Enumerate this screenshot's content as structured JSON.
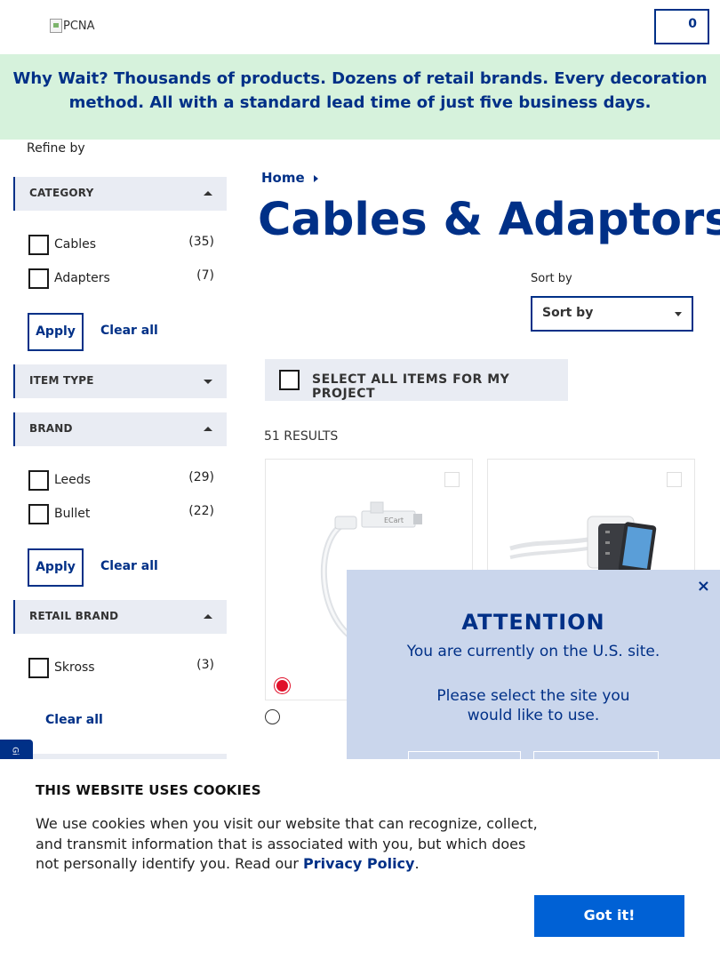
{
  "header": {
    "logo_alt": "PCNA",
    "cart_count": "0"
  },
  "promo": {
    "text": "Why Wait? Thousands of products. Dozens of retail brands. Every decoration method. All with a standard lead time of just five business days."
  },
  "sidebar": {
    "refine_label": "Refine by",
    "category": {
      "title": "CATEGORY",
      "options": [
        {
          "label": "Cables",
          "count": "(35)"
        },
        {
          "label": "Adapters",
          "count": "(7)"
        }
      ],
      "apply": "Apply",
      "clear": "Clear all"
    },
    "item_type": {
      "title": "ITEM TYPE"
    },
    "brand": {
      "title": "BRAND",
      "options": [
        {
          "label": "Leeds",
          "count": "(29)"
        },
        {
          "label": "Bullet",
          "count": "(22)"
        }
      ],
      "apply": "Apply",
      "clear": "Clear all"
    },
    "retail_brand": {
      "title": "RETAIL BRAND",
      "options": [
        {
          "label": "Skross",
          "count": "(3)"
        }
      ],
      "clear": "Clear all"
    }
  },
  "main": {
    "breadcrumb": "Home",
    "title": "Cables & Adaptors",
    "sort_label": "Sort by",
    "sort_value": "Sort by",
    "select_all": "SELECT ALL ITEMS FOR MY PROJECT",
    "results": "51 RESULTS",
    "products": [
      {
        "image": "usb-cable-product",
        "swatch_color": "#e0102a"
      },
      {
        "image": "charging-hub-product"
      }
    ]
  },
  "attention": {
    "heading": "ATTENTION",
    "line1": "You are currently on the U.S. site.",
    "line2": "Please select the site you",
    "line3": "would like to use.",
    "close": "×"
  },
  "side_tab": "Gi",
  "cookie": {
    "title": "THIS WEBSITE USES COOKIES",
    "text": "We use cookies when you visit our website that can recognize, collect, and transmit information that is associated with you, but which does not personally identify you. Read our ",
    "link": "Privacy Policy",
    "period": ".",
    "button": "Got it!"
  },
  "colors": {
    "brand": "#003087",
    "promo_bg": "#d6f2dc",
    "facet_bg": "#e9ecf3",
    "modal_bg": "#cad6ec",
    "button_blue": "#0061d5"
  }
}
